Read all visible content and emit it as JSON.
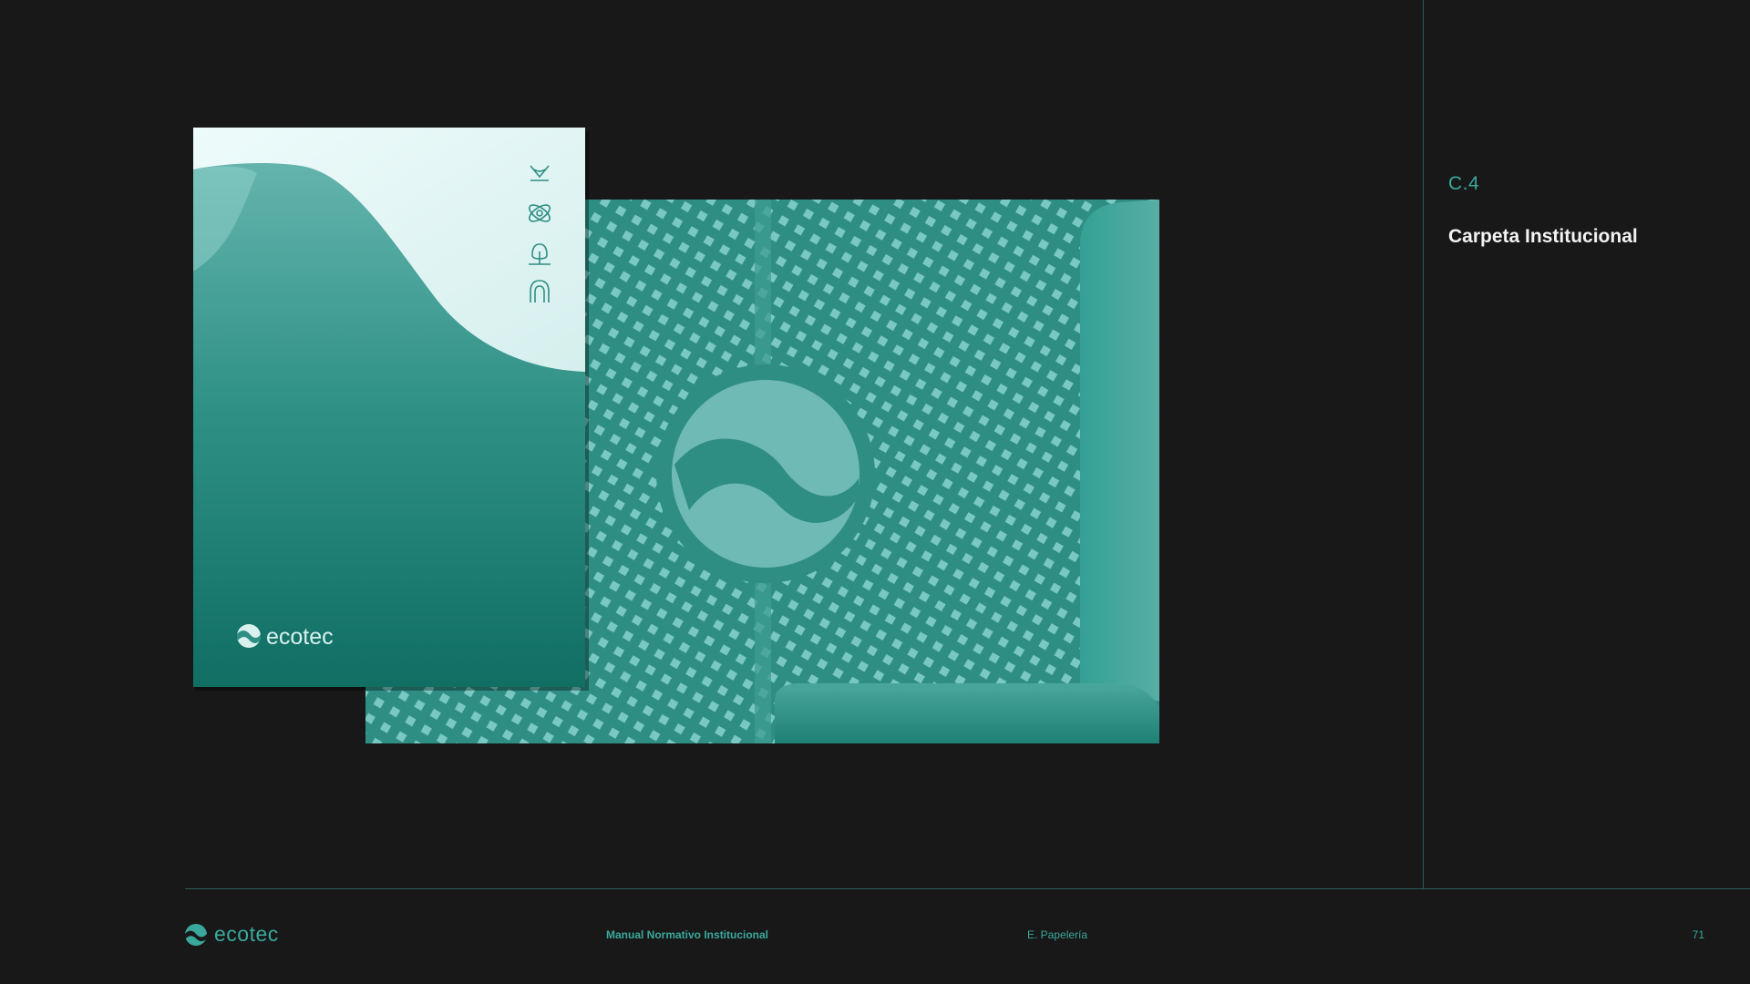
{
  "section": {
    "code": "C.4",
    "title": "Carpeta Institucional"
  },
  "mockup": {
    "brand_name": "ecotec",
    "cover_icons": [
      "lotus-icon",
      "atom-icon",
      "tree-icon",
      "arch-icon"
    ]
  },
  "footer": {
    "logo_text": "ecotec",
    "manual": "Manual Normativo Institucional",
    "section": "E. Papelería",
    "page": "71"
  },
  "colors": {
    "background": "#181818",
    "accent": "#3aa89c",
    "rule": "#2b5d57",
    "folder_teal": "#2e8d83",
    "cover_light": "#e8f8f7"
  }
}
